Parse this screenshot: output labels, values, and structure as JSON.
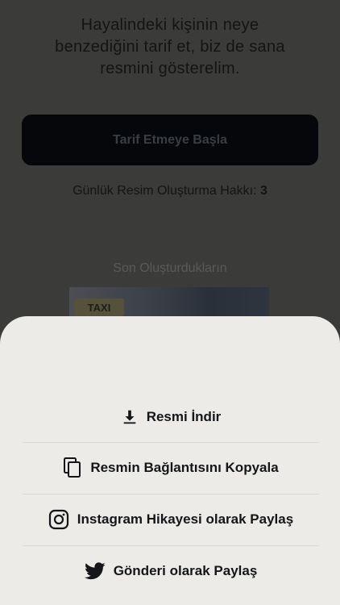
{
  "intro": {
    "line1": "Hayalindeki kişinin neye",
    "line2": "benzediğini tarif et, biz de sana",
    "line3": "resmini gösterelim."
  },
  "start_button": "Tarif Etmeye Başla",
  "quota": {
    "label": "Günlük Resim Oluşturma Hakkı:",
    "value": "3"
  },
  "recent": {
    "title": "Son Oluşturdukların",
    "thumb_sign": "TAXI"
  },
  "sheet": {
    "items": [
      {
        "label": "Resmi İndir",
        "icon": "download-icon"
      },
      {
        "label": "Resmin Bağlantısını Kopyala",
        "icon": "copy-icon"
      },
      {
        "label": "Instagram Hikayesi olarak Paylaş",
        "icon": "instagram-icon"
      },
      {
        "label": "Gönderi olarak Paylaş",
        "icon": "twitter-icon"
      }
    ]
  },
  "colors": {
    "overlay_background": "#3b3b3a",
    "sheet_background": "#ecebe7",
    "button_dark": "#05070b",
    "text_dark": "#14161a"
  }
}
